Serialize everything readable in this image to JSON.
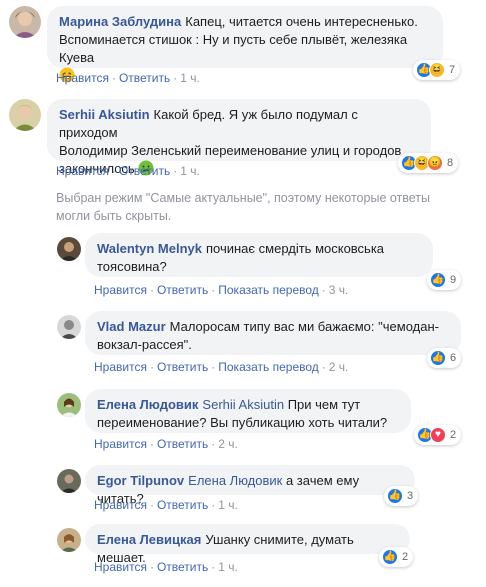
{
  "comments": [
    {
      "author": "Марина Заблудина",
      "line1": "Капец, читается очень интересненько.",
      "line2": "Вспоминается стишок : Ну и пусть себе плывёт, железяка Куева",
      "emoji": "rolling-laughing-emoji",
      "like_label": "Нравится",
      "reply_label": "Ответить",
      "time": "1 ч.",
      "reaction_count": "7",
      "reactions": [
        "like",
        "haha"
      ]
    },
    {
      "author": "Serhii Aksiutin",
      "line1": "Какой бред. Я уж было подумал с приходом",
      "line2": "Володимир Зеленський переименование улиц и городов",
      "line3": "закончилось",
      "emoji": "nauseated-face-emoji",
      "like_label": "Нравится",
      "reply_label": "Ответить",
      "time": "1 ч.",
      "reaction_count": "8",
      "reactions": [
        "like",
        "haha",
        "angry"
      ]
    }
  ],
  "notice": {
    "line1": "Выбран режим \"Самые актуальные\", поэтому некоторые ответы",
    "line2": "могли быть скрыты."
  },
  "replies": [
    {
      "author": "Walentyn Melnyk",
      "line1": "починає смердіть московська",
      "line2": "тоясовина?",
      "like_label": "Нравится",
      "reply_label": "Ответить",
      "translate_label": "Показать перевод",
      "time": "3 ч.",
      "reaction_count": "9",
      "reactions": [
        "like"
      ]
    },
    {
      "author": "Vlad Mazur",
      "line1": "Малоросам типу вас ми бажаємо: \"чемодан-",
      "line2": "вокзал-рассея\".",
      "like_label": "Нравится",
      "reply_label": "Ответить",
      "translate_label": "Показать перевод",
      "time": "2 ч.",
      "reaction_count": "6",
      "reactions": [
        "like"
      ]
    },
    {
      "author": "Елена Людовик",
      "tag": "Serhii Aksiutin",
      "line1": "При чем тут",
      "line2": "переименование? Вы публикацию хоть читали?",
      "like_label": "Нравится",
      "reply_label": "Ответить",
      "time": "2 ч.",
      "reaction_count": "2",
      "reactions": [
        "like",
        "love"
      ]
    },
    {
      "author": "Egor Tilpunov",
      "tag": "Елена Людовик",
      "line1": "а зачем ему читать?",
      "like_label": "Нравится",
      "reply_label": "Ответить",
      "time": "1 ч.",
      "reaction_count": "3",
      "reactions": [
        "like"
      ]
    },
    {
      "author": "Елена Левицкая",
      "line1": "Ушанку снимите, думать мешает.",
      "like_label": "Нравится",
      "reply_label": "Ответить",
      "time": "1 ч.",
      "reaction_count": "2",
      "reactions": [
        "like"
      ]
    }
  ],
  "colors": {
    "author": "#385898",
    "action_link": "#4267b2",
    "meta": "#90949c",
    "bubble": "#f2f3f5",
    "like": "#1877f2",
    "haha": "#f7b928",
    "angry": "#f26b3a",
    "love": "#f33e58"
  }
}
